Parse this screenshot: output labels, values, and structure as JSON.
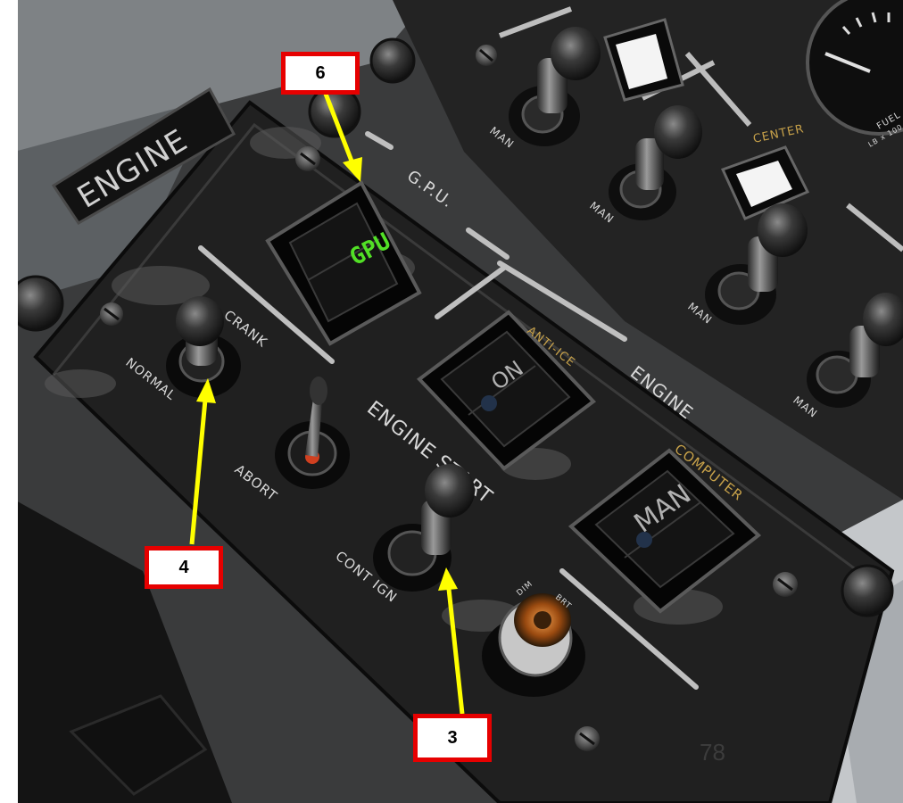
{
  "panel": {
    "engine_plate": "ENGINE",
    "gpu_section": "G.P.U.",
    "gpu_lamp": "GPU",
    "crank": "CRANK",
    "normal": "NORMAL",
    "abort": "ABORT",
    "engine_start": "ENGINE START",
    "cont_ign": "CONT IGN",
    "anti_ice_label": "ANTI-ICE",
    "on_lamp": "ON",
    "engine_section": "ENGINE",
    "computer_label": "COMPUTER",
    "man_lamp": "MAN",
    "dim_label": "DIM",
    "bright_label": "BRT"
  },
  "fuel_panel": {
    "man_labels": [
      "MAN",
      "MAN",
      "MAN",
      "MAN"
    ],
    "center_label": "CENTER",
    "gauge_label": "FUEL",
    "gauge_unit": "LB x 100"
  },
  "callouts": {
    "six": "6",
    "four": "4",
    "three": "3"
  },
  "page_number": "78",
  "colors": {
    "callout_border": "#e60000",
    "arrow": "#ffff00",
    "gpu_text": "#52e026",
    "panel": "#1c1c1c"
  }
}
